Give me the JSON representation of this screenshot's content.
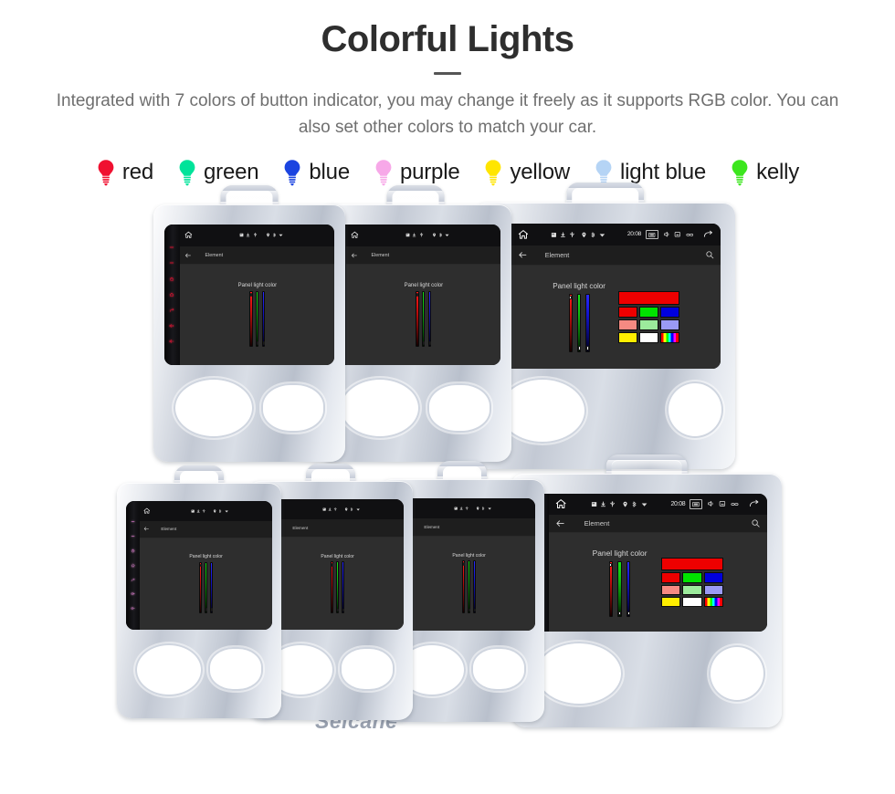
{
  "header": {
    "title": "Colorful Lights",
    "subtitle": "Integrated with 7 colors of button indicator, you may change it freely as it supports RGB color. You can also set other colors to match your car."
  },
  "legend": {
    "items": [
      {
        "label": "red",
        "color": "#f01030",
        "icon": "bulb-icon"
      },
      {
        "label": "green",
        "color": "#00e39a",
        "icon": "bulb-icon"
      },
      {
        "label": "blue",
        "color": "#1b44e0",
        "icon": "bulb-icon"
      },
      {
        "label": "purple",
        "color": "#f7a8e8",
        "icon": "bulb-icon"
      },
      {
        "label": "yellow",
        "color": "#ffe500",
        "icon": "bulb-icon"
      },
      {
        "label": "light blue",
        "color": "#b5d4f5",
        "icon": "bulb-icon"
      },
      {
        "label": "kelly",
        "color": "#3ce61e",
        "icon": "bulb-icon"
      }
    ]
  },
  "screen_ui": {
    "app_title": "Element",
    "panel_label": "Panel light color",
    "status_time": "20:08",
    "home_icon": "home-icon",
    "back_icon": "back-arrow-icon",
    "search_icon": "search-icon",
    "status_icons": [
      "sd-card-icon",
      "download-icon",
      "usb-icon",
      "location-icon",
      "bluetooth-icon",
      "wifi-icon"
    ],
    "nav_icons": [
      "screenshot-icon",
      "volume-icon",
      "apps-icon",
      "link-icon",
      "back-nav-icon"
    ],
    "sliders": [
      {
        "name": "red-slider",
        "channel": "R",
        "knob": "top"
      },
      {
        "name": "green-slider",
        "channel": "G",
        "knob": "bottom"
      },
      {
        "name": "blue-slider",
        "channel": "B",
        "knob": "bottom"
      }
    ],
    "preview_color": "#ee0000",
    "swatch_rows": [
      [
        "#ee0000",
        "#00e400",
        "#0000dd"
      ],
      [
        "#f58a82",
        "#9ceb9c",
        "#9a9af5"
      ],
      [
        "#ffee00",
        "#ffffff",
        "rainbow"
      ]
    ],
    "led_button_icons": [
      "power-led-icon",
      "menu-led-icon",
      "power-icon",
      "home-led-icon",
      "back-led-icon",
      "vol-up-icon",
      "vol-down-icon"
    ]
  },
  "brand": {
    "logo_text": "Seicane"
  },
  "units": {
    "top_row": [
      {
        "name": "radio-unit-red",
        "led_color": "#e01030",
        "led_glow": "#ff3050"
      },
      {
        "name": "radio-unit-green",
        "led_color": "#13c96b",
        "led_glow": "#2affa0"
      },
      {
        "name": "radio-unit-blue",
        "led_color": "#2a6cf0",
        "led_glow": "#5f9dff"
      }
    ],
    "bottom_row": [
      {
        "name": "radio-unit-purple",
        "led_color": "#e07ad0",
        "led_glow": "#ffb0f0"
      },
      {
        "name": "radio-unit-yellow",
        "led_color": "#e8d400",
        "led_glow": "#fff24a"
      },
      {
        "name": "radio-unit-light-blue",
        "led_color": "#9dc6ef",
        "led_glow": "#d2e8ff"
      },
      {
        "name": "radio-unit-kelly",
        "led_color": "#33d41f",
        "led_glow": "#6bff4f"
      }
    ]
  }
}
